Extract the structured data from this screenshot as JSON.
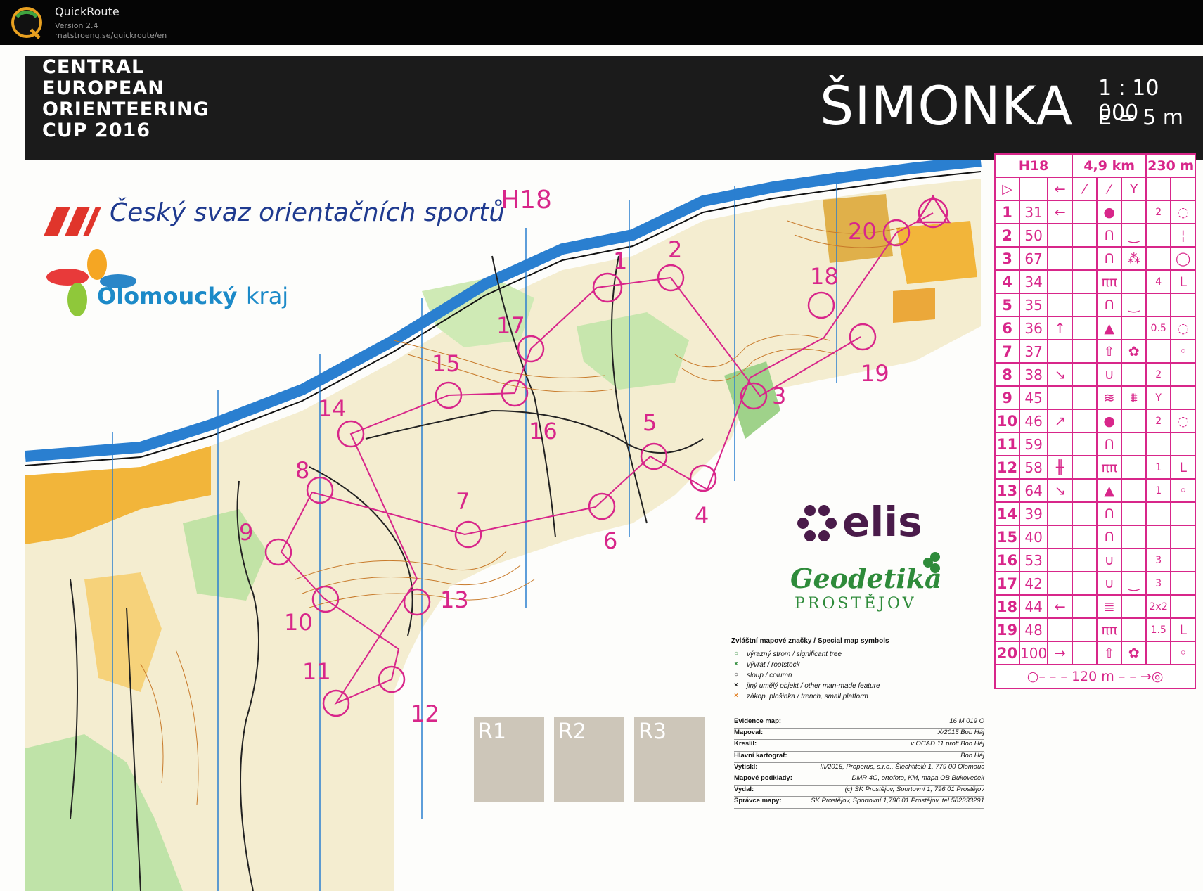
{
  "app": {
    "name": "QuickRoute",
    "version": "Version 2.4",
    "url": "matstroeng.se/quickroute/en",
    "logo_letter": "Q"
  },
  "banner": {
    "lines": [
      "CENTRAL",
      "EUROPEAN",
      "ORIENTEERING",
      "CUP 2016"
    ],
    "map_name": "ŠIMONKA",
    "scale": "1 : 10 000",
    "contour": "E = 5 m"
  },
  "sponsors": {
    "csos": "Český svaz orientačních sportů",
    "kraj_bold": "Olomoucký",
    "kraj_light": "kraj",
    "elis": "elis",
    "geodetika": "Geodetika",
    "prostejov": "PROSTĚJOV"
  },
  "course": {
    "name": "H18",
    "control_labels": [
      "1",
      "2",
      "3",
      "4",
      "5",
      "6",
      "7",
      "8",
      "9",
      "10",
      "11",
      "12",
      "13",
      "14",
      "15",
      "16",
      "17",
      "18",
      "19",
      "20"
    ]
  },
  "control_descriptions": {
    "header": {
      "class": "H18",
      "length": "4,9 km",
      "climb": "230 m"
    },
    "start_row": [
      "▷",
      "",
      "←",
      "⁄",
      "⁄",
      "Y",
      "",
      ""
    ],
    "rows": [
      {
        "n": "1",
        "code": "31",
        "c": "←",
        "d": "",
        "e": "●",
        "f": "",
        "g": "2",
        "h": "◌"
      },
      {
        "n": "2",
        "code": "50",
        "c": "",
        "d": "",
        "e": "Ո",
        "f": "‿",
        "g": "",
        "h": "¦"
      },
      {
        "n": "3",
        "code": "67",
        "c": "",
        "d": "",
        "e": "Ո",
        "f": "⁂",
        "g": "",
        "h": "◯"
      },
      {
        "n": "4",
        "code": "34",
        "c": "",
        "d": "",
        "e": "ππ",
        "f": "",
        "g": "4",
        "h": "L"
      },
      {
        "n": "5",
        "code": "35",
        "c": "",
        "d": "",
        "e": "Ո",
        "f": "‿",
        "g": "",
        "h": ""
      },
      {
        "n": "6",
        "code": "36",
        "c": "↑",
        "d": "",
        "e": "▲",
        "f": "",
        "g": "0.5",
        "h": "◌"
      },
      {
        "n": "7",
        "code": "37",
        "c": "",
        "d": "",
        "e": "⇧",
        "f": "✿",
        "g": "",
        "h": "◦"
      },
      {
        "n": "8",
        "code": "38",
        "c": "↘",
        "d": "",
        "e": "∪",
        "f": "",
        "g": "2",
        "h": ""
      },
      {
        "n": "9",
        "code": "45",
        "c": "",
        "d": "",
        "e": "≋",
        "f": "⩩",
        "g": "Y",
        "h": ""
      },
      {
        "n": "10",
        "code": "46",
        "c": "↗",
        "d": "",
        "e": "●",
        "f": "",
        "g": "2",
        "h": "◌"
      },
      {
        "n": "11",
        "code": "59",
        "c": "",
        "d": "",
        "e": "Ո",
        "f": "",
        "g": "",
        "h": ""
      },
      {
        "n": "12",
        "code": "58",
        "c": "╫",
        "d": "",
        "e": "ππ",
        "f": "",
        "g": "1",
        "h": "L"
      },
      {
        "n": "13",
        "code": "64",
        "c": "↘",
        "d": "",
        "e": "▲",
        "f": "",
        "g": "1",
        "h": "◦"
      },
      {
        "n": "14",
        "code": "39",
        "c": "",
        "d": "",
        "e": "Ո",
        "f": "",
        "g": "",
        "h": ""
      },
      {
        "n": "15",
        "code": "40",
        "c": "",
        "d": "",
        "e": "Ո",
        "f": "",
        "g": "",
        "h": ""
      },
      {
        "n": "16",
        "code": "53",
        "c": "",
        "d": "",
        "e": "∪",
        "f": "",
        "g": "3",
        "h": ""
      },
      {
        "n": "17",
        "code": "42",
        "c": "",
        "d": "",
        "e": "∪",
        "f": "‿",
        "g": "3",
        "h": ""
      },
      {
        "n": "18",
        "code": "44",
        "c": "←",
        "d": "",
        "e": "≣",
        "f": "",
        "g": "2x2",
        "h": ""
      },
      {
        "n": "19",
        "code": "48",
        "c": "",
        "d": "",
        "e": "ππ",
        "f": "",
        "g": "1.5",
        "h": "L"
      },
      {
        "n": "20",
        "code": "100",
        "c": "→",
        "d": "",
        "e": "⇧",
        "f": "✿",
        "g": "",
        "h": "◦"
      }
    ],
    "finish": "○– – –   120 m   – – →◎"
  },
  "legend": {
    "title": "Zvláštní mapové značky / Special map symbols",
    "items": [
      {
        "sym": "○",
        "color": "#2e8b3a",
        "text": "výrazný strom / significant tree"
      },
      {
        "sym": "×",
        "color": "#2e8b3a",
        "text": "vývrat / rootstock"
      },
      {
        "sym": "○",
        "color": "#111111",
        "text": "sloup / column"
      },
      {
        "sym": "×",
        "color": "#111111",
        "text": "jiný umělý objekt / other man-made feature"
      },
      {
        "sym": "×",
        "color": "#e07a1a",
        "text": "zákop, plošinka / trench, small platform"
      }
    ]
  },
  "evidence": [
    {
      "k": "Evidence map:",
      "v": "16 M 019 O"
    },
    {
      "k": "Mapoval:",
      "v": "X/2015 Bob Háj"
    },
    {
      "k": "Kreslil:",
      "v": "v OCAD 11 profi Bob Háj"
    },
    {
      "k": "Hlavní kartograf:",
      "v": "Bob Háj"
    },
    {
      "k": "Vytiskl:",
      "v": "III/2016, Properus, s.r.o., Šlechtitelů 1, 779 00 Olomouc"
    },
    {
      "k": "Mapové podklady:",
      "v": "DMR 4G, ortofoto, KM, mapa OB Bukovećek"
    },
    {
      "k": "Vydal:",
      "v": "(c) SK Prostějov, Sportovní 1, 796 01 Prostějov"
    },
    {
      "k": "Správce mapy:",
      "v": "SK Prostějov, Sportovní 1,796 01 Prostějov, tel.582333291"
    }
  ],
  "result_boxes": [
    "R1",
    "R2",
    "R3"
  ],
  "colors": {
    "course": "#d8268a",
    "river": "#2a7fd0",
    "forest_green": "#3f9a3a",
    "open_yellow": "#f2b53a"
  }
}
